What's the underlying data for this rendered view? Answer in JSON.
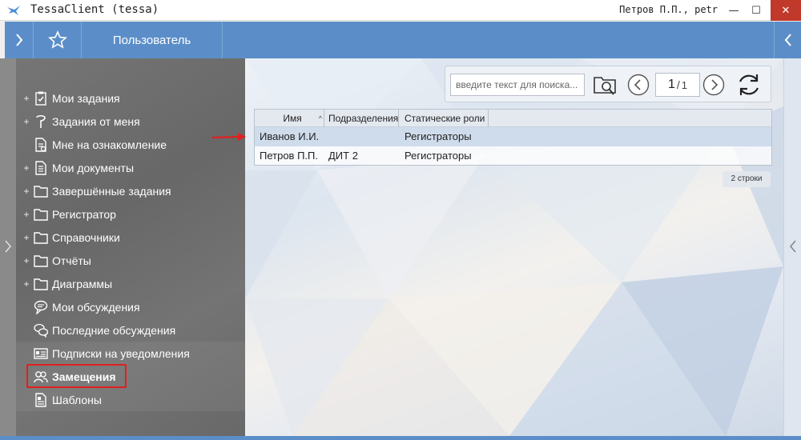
{
  "window": {
    "title": "TessaClient (tessa)",
    "user": "Петров П.П., petr",
    "minimize_glyph": "—",
    "maximize_glyph": "☐",
    "close_glyph": "✕"
  },
  "toolbar": {
    "active_tab": "Пользователь"
  },
  "sidebar": {
    "items": [
      {
        "label": "Мои задания",
        "icon": "task-check-icon",
        "expandable": true
      },
      {
        "label": "Задания от меня",
        "icon": "pin-icon",
        "expandable": true
      },
      {
        "label": "Мне на ознакомление",
        "icon": "document-review-icon",
        "expandable": false
      },
      {
        "label": "Мои документы",
        "icon": "document-icon",
        "expandable": true
      },
      {
        "label": "Завершённые задания",
        "icon": "folder-icon",
        "expandable": true
      },
      {
        "label": "Регистратор",
        "icon": "folder-icon",
        "expandable": true
      },
      {
        "label": "Справочники",
        "icon": "folder-icon",
        "expandable": true
      },
      {
        "label": "Отчёты",
        "icon": "folder-icon",
        "expandable": true
      },
      {
        "label": "Диаграммы",
        "icon": "folder-icon",
        "expandable": true
      },
      {
        "label": "Мои обсуждения",
        "icon": "chat-icon",
        "expandable": false
      },
      {
        "label": "Последние обсуждения",
        "icon": "chats-icon",
        "expandable": false
      },
      {
        "label": "Подписки на уведомления",
        "icon": "subscription-icon",
        "expandable": false
      },
      {
        "label": "Замещения",
        "icon": "users-icon",
        "expandable": false,
        "selected": true
      },
      {
        "label": "Шаблоны",
        "icon": "template-icon",
        "expandable": false
      }
    ],
    "expand_glyph": "+"
  },
  "search": {
    "placeholder": "введите текст для поиска..."
  },
  "pager": {
    "current": "1",
    "separator": "/",
    "total": "1"
  },
  "grid": {
    "columns": [
      "Имя",
      "Подразделения",
      "Статические роли"
    ],
    "sort_glyph": "^",
    "rows": [
      {
        "name": "Иванов И.И.",
        "dept": "",
        "roles": "Регистраторы",
        "selected": true
      },
      {
        "name": "Петров П.П.",
        "dept": "ДИТ 2",
        "roles": "Регистраторы",
        "selected": false
      }
    ],
    "row_count": "2 строки"
  },
  "colors": {
    "toolbar": "#5b8ec8",
    "sidebar": "#6e6e6e",
    "highlight": "#e02020",
    "close": "#c0392b"
  }
}
